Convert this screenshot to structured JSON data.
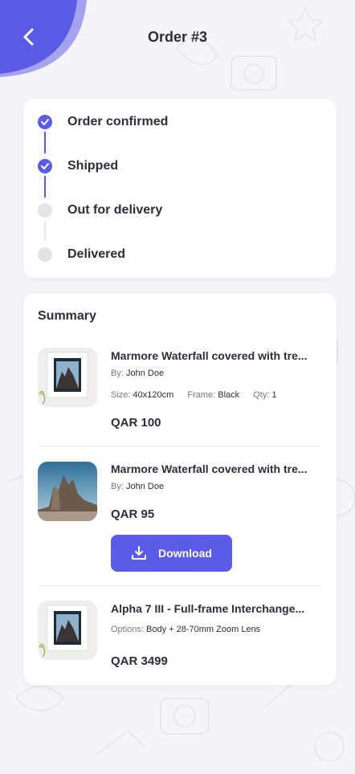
{
  "header": {
    "title": "Order #3",
    "back_icon": "chevron-left-icon"
  },
  "colors": {
    "accent": "#5b5be6",
    "background": "#f4f4f9",
    "card": "#ffffff"
  },
  "status": {
    "steps": [
      {
        "label": "Order confirmed",
        "done": true
      },
      {
        "label": "Shipped",
        "done": true
      },
      {
        "label": "Out for delivery",
        "done": false
      },
      {
        "label": "Delivered",
        "done": false
      }
    ]
  },
  "summary": {
    "title": "Summary",
    "by_label": "By:",
    "size_label": "Size:",
    "frame_label": "Frame:",
    "qty_label": "Qty:",
    "options_label": "Options:",
    "items": [
      {
        "title": "Marmore Waterfall covered with tre...",
        "author": "John Doe",
        "size": "40x120cm",
        "frame": "Black",
        "qty": "1",
        "price": "QAR 100"
      },
      {
        "title": "Marmore Waterfall covered with tre...",
        "author": "John Doe",
        "price": "QAR 95",
        "download_label": "Download"
      },
      {
        "title": "Alpha 7 III - Full-frame Interchange...",
        "options": "Body + 28-70mm Zoom Lens",
        "price": "QAR 3499"
      }
    ]
  }
}
